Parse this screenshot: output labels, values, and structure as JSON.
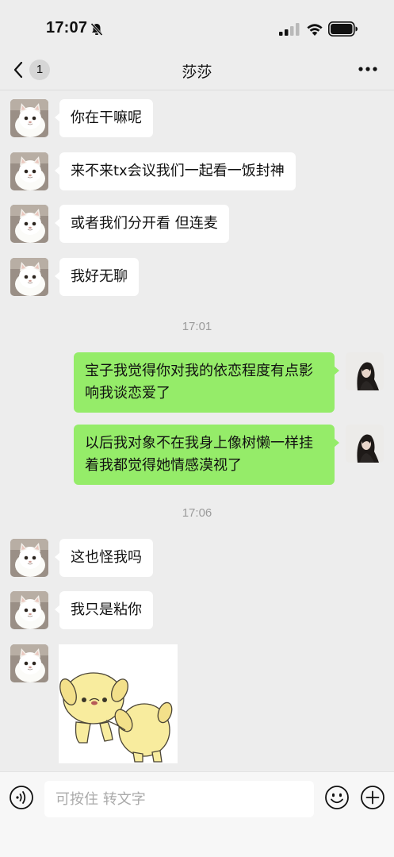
{
  "status_bar": {
    "time": "17:07"
  },
  "nav": {
    "unread_count": "1",
    "title": "莎莎"
  },
  "messages": [
    {
      "type": "in",
      "text": "你在干嘛呢"
    },
    {
      "type": "in",
      "text": "来不来tx会议我们一起看一饭封神"
    },
    {
      "type": "in",
      "text": "或者我们分开看 但连麦"
    },
    {
      "type": "in",
      "text": "我好无聊"
    },
    {
      "type": "time",
      "text": "17:01"
    },
    {
      "type": "out",
      "text": "宝子我觉得你对我的依恋程度有点影响我谈恋爱了"
    },
    {
      "type": "out",
      "text": "以后我对象不在我身上像树懒一样挂着我都觉得她情感漠视了"
    },
    {
      "type": "time",
      "text": "17:06"
    },
    {
      "type": "in",
      "text": "这也怪我吗"
    },
    {
      "type": "in",
      "text": "我只是粘你"
    },
    {
      "type": "in-sticker",
      "text": ""
    }
  ],
  "input_bar": {
    "placeholder": "可按住 转文字"
  },
  "icons": {
    "back": "chevron-left-icon",
    "more": "more-dots-icon",
    "voice": "voice-icon",
    "emoji": "emoji-icon",
    "plus": "plus-icon",
    "bell": "bell-slash-icon"
  },
  "colors": {
    "background": "#ededed",
    "outgoing_bubble": "#95ec69",
    "incoming_bubble": "#ffffff"
  }
}
